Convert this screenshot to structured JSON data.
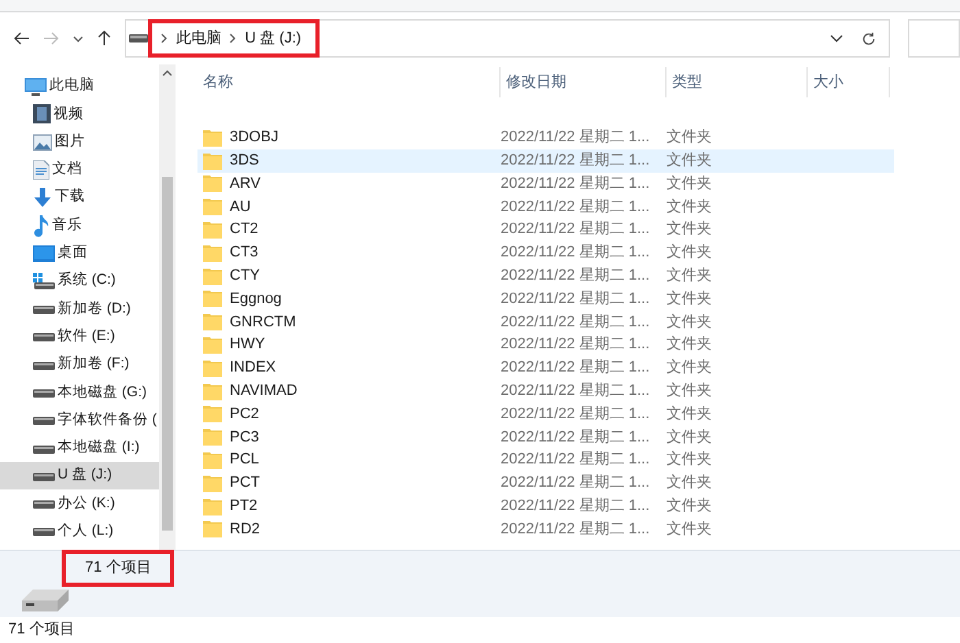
{
  "address_bar": {
    "path": [
      "此电脑",
      "U 盘 (J:)"
    ],
    "highlighted": true
  },
  "sidebar": {
    "items": [
      {
        "label": "此电脑",
        "kind": "computer",
        "selected": false,
        "children": [
          {
            "label": "视频",
            "kind": "video",
            "selected": false
          },
          {
            "label": "图片",
            "kind": "pictures",
            "selected": false
          },
          {
            "label": "文档",
            "kind": "documents",
            "selected": false
          },
          {
            "label": "下载",
            "kind": "downloads",
            "selected": false
          },
          {
            "label": "音乐",
            "kind": "music",
            "selected": false
          },
          {
            "label": "桌面",
            "kind": "desktop",
            "selected": false
          },
          {
            "label": "系统 (C:)",
            "kind": "system-drive",
            "selected": false
          },
          {
            "label": "新加卷 (D:)",
            "kind": "drive",
            "selected": false
          },
          {
            "label": "软件 (E:)",
            "kind": "drive",
            "selected": false
          },
          {
            "label": "新加卷 (F:)",
            "kind": "drive",
            "selected": false
          },
          {
            "label": "本地磁盘 (G:)",
            "kind": "drive",
            "selected": false
          },
          {
            "label": "字体软件备份 (",
            "kind": "drive",
            "selected": false
          },
          {
            "label": "本地磁盘 (I:)",
            "kind": "drive",
            "selected": false
          },
          {
            "label": "U 盘 (J:)",
            "kind": "drive",
            "selected": true
          },
          {
            "label": "办公 (K:)",
            "kind": "drive",
            "selected": false
          },
          {
            "label": "个人 (L:)",
            "kind": "drive",
            "selected": false
          }
        ]
      }
    ]
  },
  "table": {
    "columns": [
      "名称",
      "修改日期",
      "类型",
      "大小"
    ],
    "rows": [
      {
        "name": "3DOBJ",
        "modified": "2022/11/22 星期二 1...",
        "type": "文件夹",
        "selected": false
      },
      {
        "name": "3DS",
        "modified": "2022/11/22 星期二 1...",
        "type": "文件夹",
        "selected": true
      },
      {
        "name": "ARV",
        "modified": "2022/11/22 星期二 1...",
        "type": "文件夹",
        "selected": false
      },
      {
        "name": "AU",
        "modified": "2022/11/22 星期二 1...",
        "type": "文件夹",
        "selected": false
      },
      {
        "name": "CT2",
        "modified": "2022/11/22 星期二 1...",
        "type": "文件夹",
        "selected": false
      },
      {
        "name": "CT3",
        "modified": "2022/11/22 星期二 1...",
        "type": "文件夹",
        "selected": false
      },
      {
        "name": "CTY",
        "modified": "2022/11/22 星期二 1...",
        "type": "文件夹",
        "selected": false
      },
      {
        "name": "Eggnog",
        "modified": "2022/11/22 星期二 1...",
        "type": "文件夹",
        "selected": false
      },
      {
        "name": "GNRCTM",
        "modified": "2022/11/22 星期二 1...",
        "type": "文件夹",
        "selected": false
      },
      {
        "name": "HWY",
        "modified": "2022/11/22 星期二 1...",
        "type": "文件夹",
        "selected": false
      },
      {
        "name": "INDEX",
        "modified": "2022/11/22 星期二 1...",
        "type": "文件夹",
        "selected": false
      },
      {
        "name": "NAVIMAD",
        "modified": "2022/11/22 星期二 1...",
        "type": "文件夹",
        "selected": false
      },
      {
        "name": "PC2",
        "modified": "2022/11/22 星期二 1...",
        "type": "文件夹",
        "selected": false
      },
      {
        "name": "PC3",
        "modified": "2022/11/22 星期二 1...",
        "type": "文件夹",
        "selected": false
      },
      {
        "name": "PCL",
        "modified": "2022/11/22 星期二 1...",
        "type": "文件夹",
        "selected": false
      },
      {
        "name": "PCT",
        "modified": "2022/11/22 星期二 1...",
        "type": "文件夹",
        "selected": false
      },
      {
        "name": "PT2",
        "modified": "2022/11/22 星期二 1...",
        "type": "文件夹",
        "selected": false
      },
      {
        "name": "RD2",
        "modified": "2022/11/22 星期二 1...",
        "type": "文件夹",
        "selected": false
      }
    ]
  },
  "details_pane": {
    "item_count": "71 个项目",
    "highlighted": true
  },
  "status_bar": {
    "item_count": "71 个项目"
  }
}
